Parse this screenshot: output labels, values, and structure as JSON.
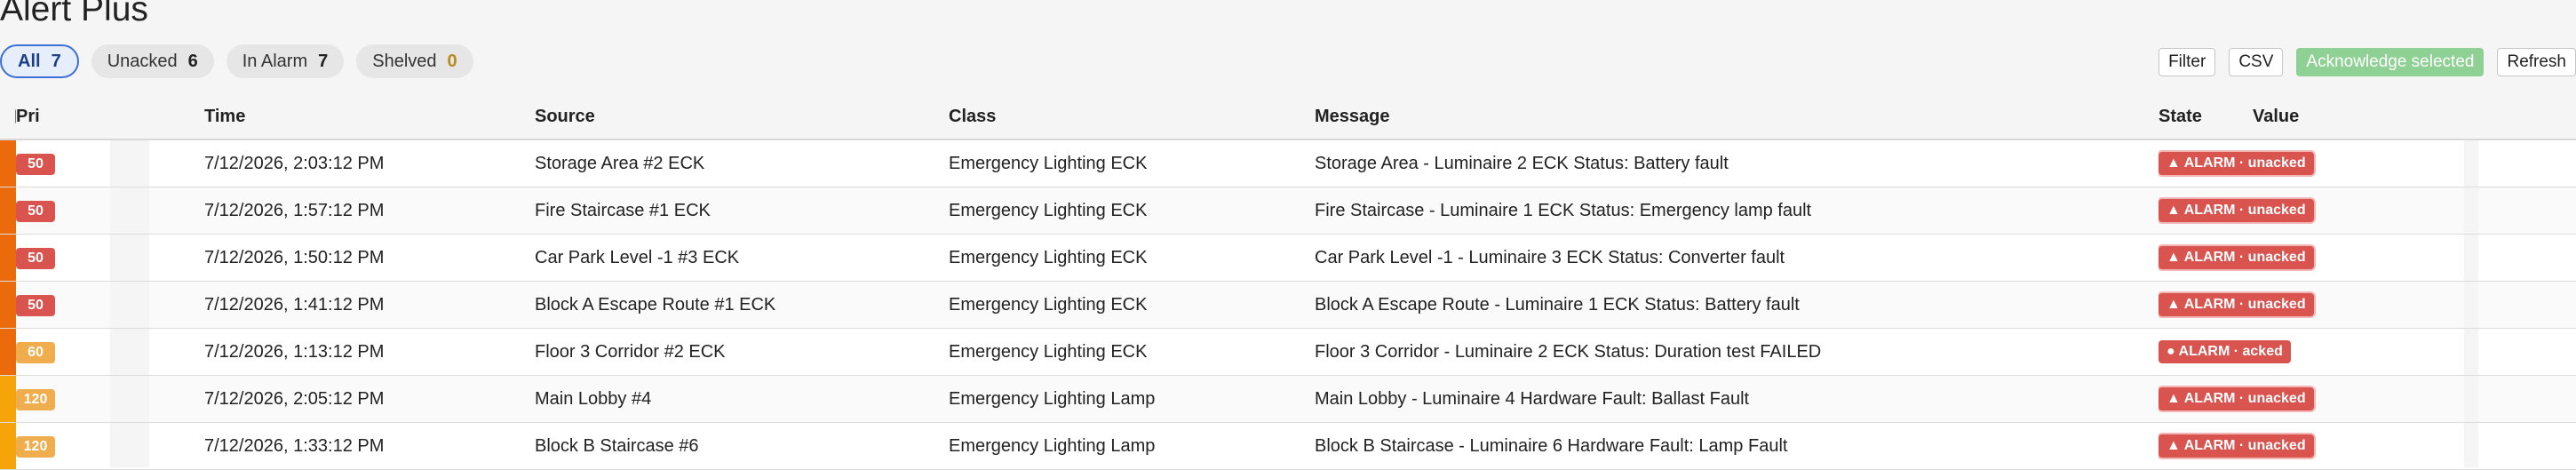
{
  "app": {
    "title": "Alert Plus"
  },
  "filters": [
    {
      "label": "All",
      "count": "7",
      "active": true
    },
    {
      "label": "Unacked",
      "count": "6",
      "active": false
    },
    {
      "label": "In Alarm",
      "count": "7",
      "active": false
    },
    {
      "label": "Shelved",
      "count": "0",
      "active": false
    }
  ],
  "toolbar": {
    "filter_label": "Filter",
    "csv_label": "CSV",
    "ack_label": "Acknowledge selected",
    "refresh_label": "Refresh"
  },
  "columns": {
    "pri": "Pri",
    "time": "Time",
    "source": "Source",
    "class": "Class",
    "message": "Message",
    "state": "State",
    "value": "Value"
  },
  "colors": {
    "priority_50": "#d9534f",
    "priority_60_120": "#f0ad4e",
    "bar_high": "#ea6a0c",
    "bar_medium": "#f5a50a",
    "state_bg": "#d9534f",
    "accent": "#3d6fd6"
  },
  "rows": [
    {
      "priority": "50",
      "time": "7/12/2026, 2:03:12 PM",
      "source": "Storage Area #2 ECK",
      "class": "Emergency Lighting ECK",
      "message": "Storage Area - Luminaire 2 ECK Status: Battery fault",
      "state": "▲ ALARM · unacked",
      "value": "",
      "bar": "high",
      "pri_level": "critical",
      "state_type": "unacked"
    },
    {
      "priority": "50",
      "time": "7/12/2026, 1:57:12 PM",
      "source": "Fire Staircase #1 ECK",
      "class": "Emergency Lighting ECK",
      "message": "Fire Staircase - Luminaire 1 ECK Status: Emergency lamp fault",
      "state": "▲ ALARM · unacked",
      "value": "",
      "bar": "high",
      "pri_level": "critical",
      "state_type": "unacked"
    },
    {
      "priority": "50",
      "time": "7/12/2026, 1:50:12 PM",
      "source": "Car Park Level -1 #3 ECK",
      "class": "Emergency Lighting ECK",
      "message": "Car Park Level -1 - Luminaire 3 ECK Status: Converter fault",
      "state": "▲ ALARM · unacked",
      "value": "",
      "bar": "high",
      "pri_level": "critical",
      "state_type": "unacked"
    },
    {
      "priority": "50",
      "time": "7/12/2026, 1:41:12 PM",
      "source": "Block A Escape Route #1 ECK",
      "class": "Emergency Lighting ECK",
      "message": "Block A Escape Route - Luminaire 1 ECK Status: Battery fault",
      "state": "▲ ALARM · unacked",
      "value": "",
      "bar": "high",
      "pri_level": "critical",
      "state_type": "unacked"
    },
    {
      "priority": "60",
      "time": "7/12/2026, 1:13:12 PM",
      "source": "Floor 3 Corridor #2 ECK",
      "class": "Emergency Lighting ECK",
      "message": "Floor 3 Corridor - Luminaire 2 ECK Status: Duration test FAILED",
      "state": "● ALARM · acked",
      "value": "",
      "bar": "high",
      "pri_level": "warning",
      "state_type": "acked"
    },
    {
      "priority": "120",
      "time": "7/12/2026, 2:05:12 PM",
      "source": "Main Lobby #4",
      "class": "Emergency Lighting Lamp",
      "message": "Main Lobby - Luminaire 4 Hardware Fault: Ballast Fault",
      "state": "▲ ALARM · unacked",
      "value": "",
      "bar": "medium",
      "pri_level": "warning",
      "state_type": "unacked"
    },
    {
      "priority": "120",
      "time": "7/12/2026, 1:33:12 PM",
      "source": "Block B Staircase #6",
      "class": "Emergency Lighting Lamp",
      "message": "Block B Staircase - Luminaire 6 Hardware Fault: Lamp Fault",
      "state": "▲ ALARM · unacked",
      "value": "",
      "bar": "medium",
      "pri_level": "warning",
      "state_type": "unacked"
    }
  ]
}
